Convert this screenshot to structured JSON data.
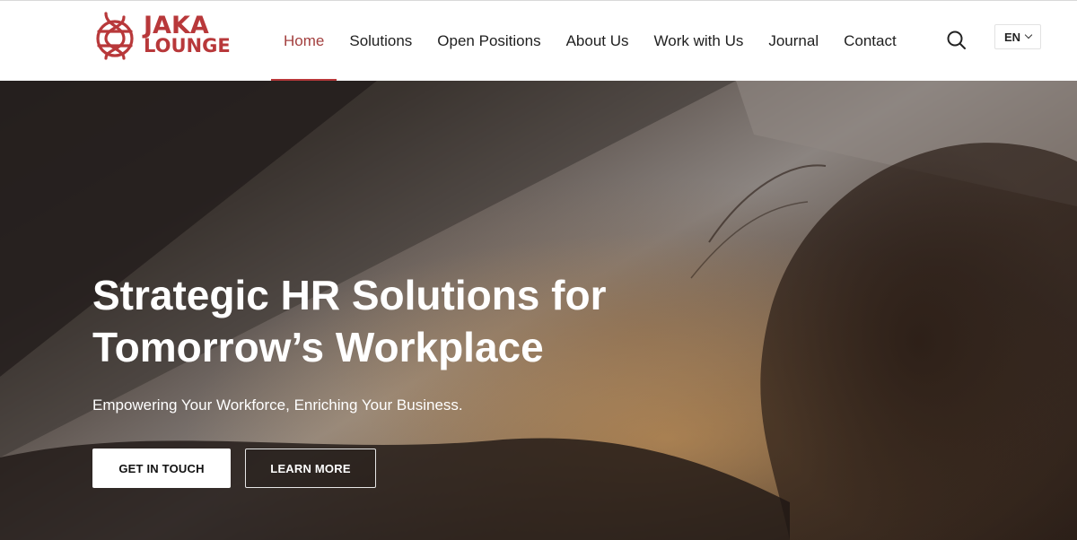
{
  "header": {
    "logo": {
      "line1": "JAKA",
      "line2": "LOUNGE",
      "icon": "knot-logo-icon",
      "color": "#b8383a"
    },
    "nav": [
      {
        "label": "Home",
        "active": true
      },
      {
        "label": "Solutions",
        "active": false
      },
      {
        "label": "Open Positions",
        "active": false
      },
      {
        "label": "About Us",
        "active": false
      },
      {
        "label": "Work with Us",
        "active": false
      },
      {
        "label": "Journal",
        "active": false
      },
      {
        "label": "Contact",
        "active": false
      }
    ],
    "search_icon": "search-icon",
    "language": "EN"
  },
  "hero": {
    "title_line1": "Strategic HR Solutions for",
    "title_line2": "Tomorrow’s Workplace",
    "subtitle": "Empowering Your Workforce, Enriching Your Business.",
    "primary_button": "GET IN TOUCH",
    "secondary_button": "LEARN MORE"
  },
  "colors": {
    "accent": "#b8383a",
    "nav_text": "#1f1f1f",
    "hero_text": "#ffffff"
  }
}
